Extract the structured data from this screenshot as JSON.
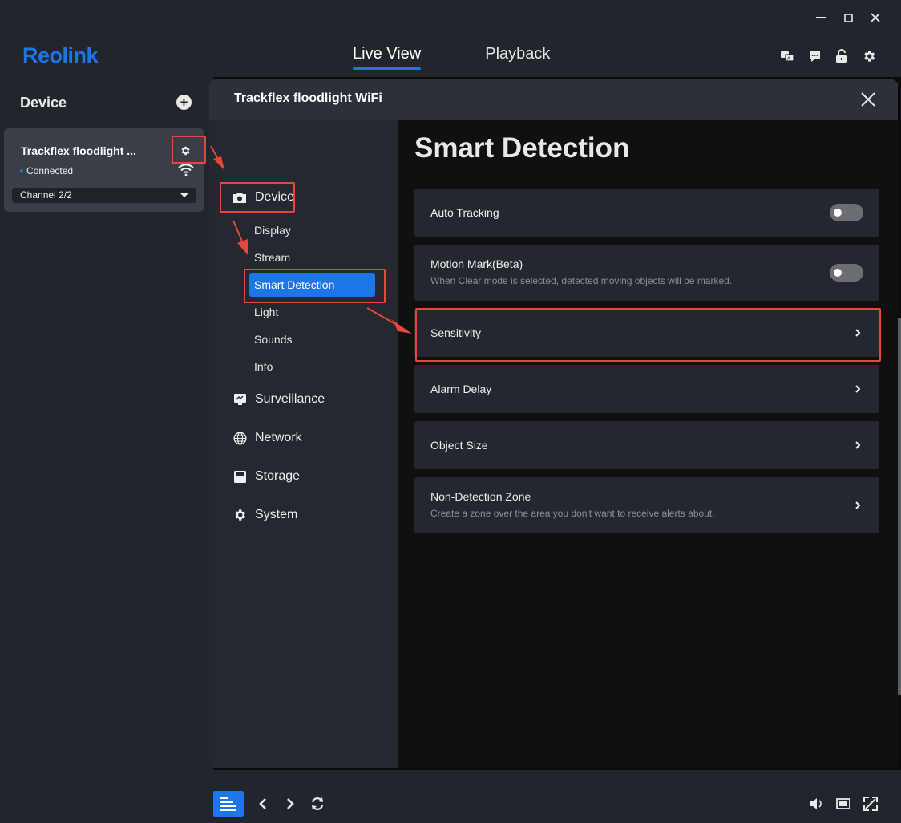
{
  "app": {
    "logo_text": "Reolink",
    "brand_color": "#1c76e8",
    "window_controls": {
      "minimize": "minimize-icon",
      "maximize": "maximize-icon",
      "close": "close-icon"
    },
    "nav_tabs": [
      {
        "label": "Live View",
        "active": true
      },
      {
        "label": "Playback",
        "active": false
      }
    ],
    "top_icons": [
      "language-icon",
      "message-icon",
      "unlock-icon",
      "gear-icon"
    ]
  },
  "device_panel": {
    "header": "Device",
    "add_icon": "plus-icon",
    "device": {
      "name": "Trackflex floodlight ...",
      "status": "Connected",
      "channel": "Channel 2/2"
    }
  },
  "dialog": {
    "title": "Trackflex floodlight WiFi",
    "sidebar": {
      "device_label": "Device",
      "device_subitems": [
        {
          "label": "Display",
          "active": false
        },
        {
          "label": "Stream",
          "active": false
        },
        {
          "label": "Smart Detection",
          "active": true
        },
        {
          "label": "Light",
          "active": false
        },
        {
          "label": "Sounds",
          "active": false
        },
        {
          "label": "Info",
          "active": false
        }
      ],
      "categories": [
        {
          "label": "Surveillance",
          "icon": "surveillance-icon"
        },
        {
          "label": "Network",
          "icon": "globe-icon"
        },
        {
          "label": "Storage",
          "icon": "storage-icon"
        },
        {
          "label": "System",
          "icon": "gear-icon"
        }
      ]
    },
    "content": {
      "title": "Smart Detection",
      "rows": [
        {
          "label": "Auto Tracking",
          "type": "toggle",
          "on": false
        },
        {
          "label": "Motion Mark(Beta)",
          "desc": "When Clear mode is selected, detected moving objects will be marked.",
          "type": "toggle",
          "on": false
        },
        {
          "label": "Sensitivity",
          "type": "link"
        },
        {
          "label": "Alarm Delay",
          "type": "link"
        },
        {
          "label": "Object Size",
          "type": "link"
        },
        {
          "label": "Non-Detection Zone",
          "desc": "Create a zone over the area you don't want to receive alerts about.",
          "type": "link"
        }
      ]
    }
  },
  "annotation_color": "#e8453c",
  "bottom_toolbar": {
    "left": [
      "grid-layout-icon",
      "chevron-left-icon",
      "chevron-right-icon",
      "refresh-icon"
    ],
    "right": [
      "volume-icon",
      "screen-icon",
      "fullscreen-icon"
    ]
  }
}
